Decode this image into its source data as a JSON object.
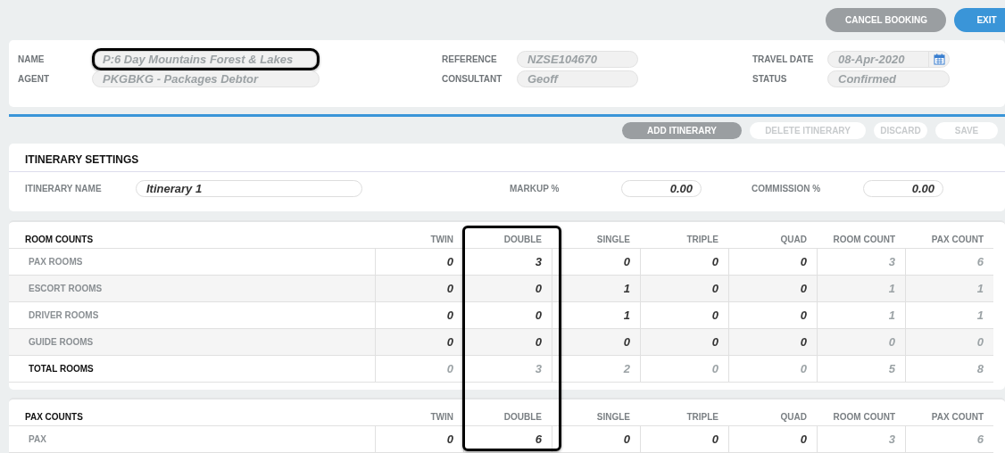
{
  "top_buttons": [
    {
      "label": "CANCEL BOOKING",
      "kind": "gray",
      "disabled": false
    },
    {
      "label": "EXIT",
      "kind": "blue",
      "disabled": false
    }
  ],
  "header": {
    "fields": [
      {
        "label": "NAME",
        "value": "P:6 Day Mountains Forest & Lakes",
        "highlighted": true,
        "kind": "text"
      },
      {
        "label": "REFERENCE",
        "value": "NZSE104670",
        "highlighted": false,
        "kind": "text"
      },
      {
        "label": "TRAVEL DATE",
        "value": "08-Apr-2020",
        "highlighted": false,
        "kind": "date"
      },
      {
        "label": "AGENT",
        "value": "PKGBKG - Packages Debtor",
        "highlighted": false,
        "kind": "text"
      },
      {
        "label": "CONSULTANT",
        "value": "Geoff",
        "highlighted": false,
        "kind": "text"
      },
      {
        "label": "STATUS",
        "value": "Confirmed",
        "highlighted": false,
        "kind": "text"
      }
    ]
  },
  "action_buttons": [
    {
      "label": "ADD ITINERARY",
      "kind": "gray",
      "disabled": false
    },
    {
      "label": "DELETE ITINERARY",
      "kind": "gray",
      "disabled": true
    },
    {
      "label": "DISCARD",
      "kind": "gray",
      "disabled": true
    },
    {
      "label": "SAVE",
      "kind": "gray",
      "disabled": true
    }
  ],
  "itinerary_settings": {
    "title": "ITINERARY SETTINGS",
    "fields": [
      {
        "label": "ITINERARY NAME",
        "value": "Itinerary 1"
      },
      {
        "label": "MARKUP %",
        "value": "0.00"
      },
      {
        "label": "COMMISSION %",
        "value": "0.00"
      }
    ]
  },
  "room_counts": {
    "title": "ROOM COUNTS",
    "columns": [
      {
        "label": "TWIN",
        "highlighted": false
      },
      {
        "label": "DOUBLE",
        "highlighted": true
      },
      {
        "label": "SINGLE",
        "highlighted": false
      },
      {
        "label": "TRIPLE",
        "highlighted": false
      },
      {
        "label": "QUAD",
        "highlighted": false
      },
      {
        "label": "ROOM COUNT",
        "highlighted": false
      },
      {
        "label": "PAX COUNT",
        "highlighted": false
      }
    ],
    "rows": [
      {
        "label": "PAX ROOMS",
        "total": false,
        "cells": [
          {
            "value": "0",
            "computed": false
          },
          {
            "value": "3",
            "computed": false
          },
          {
            "value": "0",
            "computed": false
          },
          {
            "value": "0",
            "computed": false
          },
          {
            "value": "0",
            "computed": false
          },
          {
            "value": "3",
            "computed": true
          },
          {
            "value": "6",
            "computed": true
          }
        ]
      },
      {
        "label": "ESCORT ROOMS",
        "total": false,
        "cells": [
          {
            "value": "0",
            "computed": false
          },
          {
            "value": "0",
            "computed": false
          },
          {
            "value": "1",
            "computed": false
          },
          {
            "value": "0",
            "computed": false
          },
          {
            "value": "0",
            "computed": false
          },
          {
            "value": "1",
            "computed": true
          },
          {
            "value": "1",
            "computed": true
          }
        ]
      },
      {
        "label": "DRIVER ROOMS",
        "total": false,
        "cells": [
          {
            "value": "0",
            "computed": false
          },
          {
            "value": "0",
            "computed": false
          },
          {
            "value": "1",
            "computed": false
          },
          {
            "value": "0",
            "computed": false
          },
          {
            "value": "0",
            "computed": false
          },
          {
            "value": "1",
            "computed": true
          },
          {
            "value": "1",
            "computed": true
          }
        ]
      },
      {
        "label": "GUIDE ROOMS",
        "total": false,
        "cells": [
          {
            "value": "0",
            "computed": false
          },
          {
            "value": "0",
            "computed": false
          },
          {
            "value": "0",
            "computed": false
          },
          {
            "value": "0",
            "computed": false
          },
          {
            "value": "0",
            "computed": false
          },
          {
            "value": "0",
            "computed": true
          },
          {
            "value": "0",
            "computed": true
          }
        ]
      },
      {
        "label": "TOTAL ROOMS",
        "total": true,
        "cells": [
          {
            "value": "0",
            "computed": true
          },
          {
            "value": "3",
            "computed": true
          },
          {
            "value": "2",
            "computed": true
          },
          {
            "value": "0",
            "computed": true
          },
          {
            "value": "0",
            "computed": true
          },
          {
            "value": "5",
            "computed": true
          },
          {
            "value": "8",
            "computed": true
          }
        ]
      }
    ]
  },
  "pax_counts": {
    "title": "PAX COUNTS",
    "columns": [
      {
        "label": "TWIN",
        "highlighted": false
      },
      {
        "label": "DOUBLE",
        "highlighted": true
      },
      {
        "label": "SINGLE",
        "highlighted": false
      },
      {
        "label": "TRIPLE",
        "highlighted": false
      },
      {
        "label": "QUAD",
        "highlighted": false
      },
      {
        "label": "ROOM COUNT",
        "highlighted": false
      },
      {
        "label": "PAX COUNT",
        "highlighted": false
      }
    ],
    "rows": [
      {
        "label": "PAX",
        "total": false,
        "cells": [
          {
            "value": "0",
            "computed": false
          },
          {
            "value": "6",
            "computed": false
          },
          {
            "value": "0",
            "computed": false
          },
          {
            "value": "0",
            "computed": false
          },
          {
            "value": "0",
            "computed": false
          },
          {
            "value": "3",
            "computed": true
          },
          {
            "value": "6",
            "computed": true
          }
        ]
      }
    ]
  }
}
